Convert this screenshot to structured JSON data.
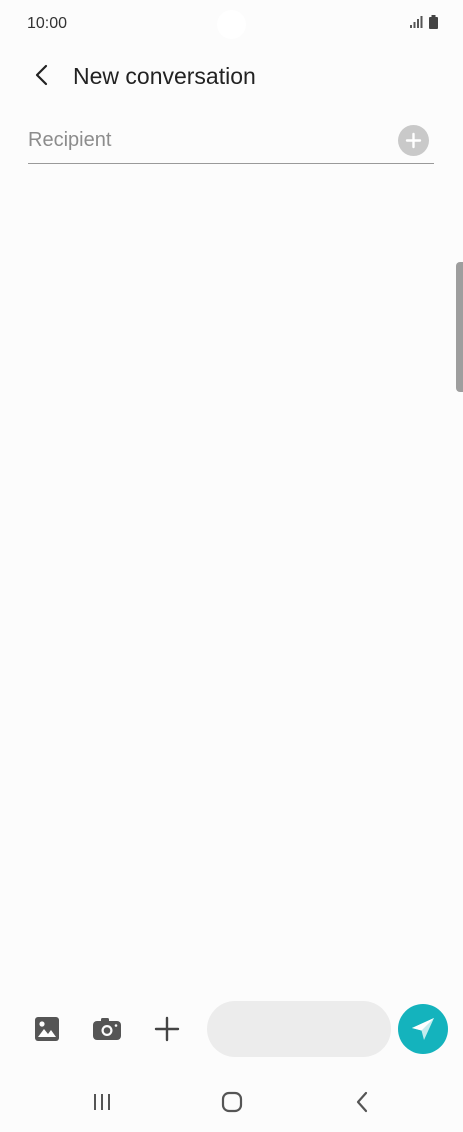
{
  "status_bar": {
    "time": "10:00",
    "icons": [
      "signal-icon",
      "battery-icon"
    ]
  },
  "header": {
    "title": "New conversation",
    "back_icon": "chevron-left-icon"
  },
  "recipient": {
    "value": "",
    "placeholder": "Recipient",
    "add_icon": "plus-circle-icon"
  },
  "composer": {
    "attach_icons": [
      "image-icon",
      "camera-icon",
      "plus-icon"
    ],
    "message_value": "",
    "message_placeholder": "",
    "send_icon": "send-icon",
    "send_color": "#14b3bd"
  },
  "nav_bar": {
    "buttons": [
      "recents-icon",
      "home-icon",
      "back-icon"
    ]
  }
}
